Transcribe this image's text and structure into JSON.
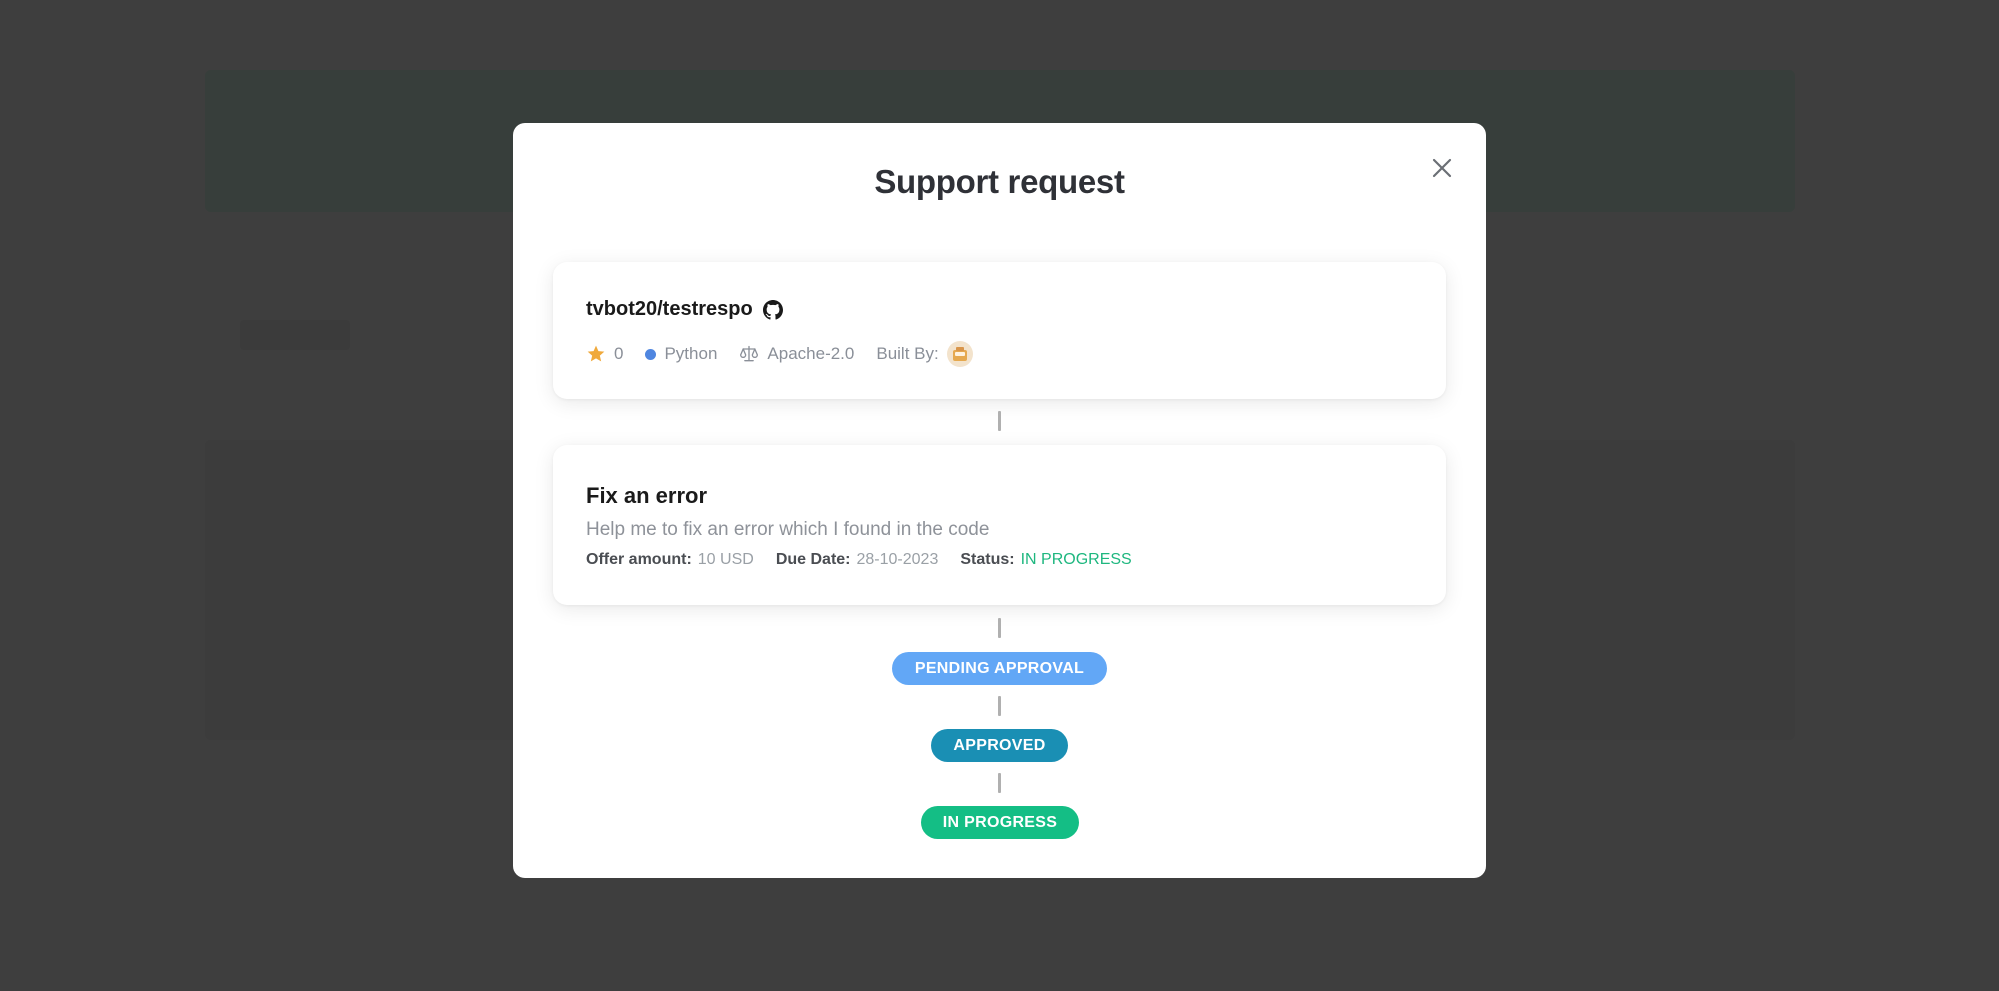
{
  "modal": {
    "title": "Support request",
    "close_icon": "close-icon"
  },
  "repo": {
    "name": "tvbot20/testrespo",
    "github_icon": "github-icon",
    "stars": "0",
    "language": "Python",
    "language_color": "#4f86e0",
    "license": "Apache-2.0",
    "built_by_label": "Built By:"
  },
  "task": {
    "title": "Fix an error",
    "description": "Help me to fix an error which I found in the code",
    "offer_label": "Offer amount:",
    "offer_value": "10 USD",
    "due_label": "Due Date:",
    "due_value": "28-10-2023",
    "status_label": "Status:",
    "status_value": "IN PROGRESS"
  },
  "timeline": [
    {
      "label": "PENDING APPROVAL",
      "color": "#62a7f6"
    },
    {
      "label": "APPROVED",
      "color": "#1a8fb4"
    },
    {
      "label": "IN PROGRESS",
      "color": "#14be85"
    }
  ]
}
